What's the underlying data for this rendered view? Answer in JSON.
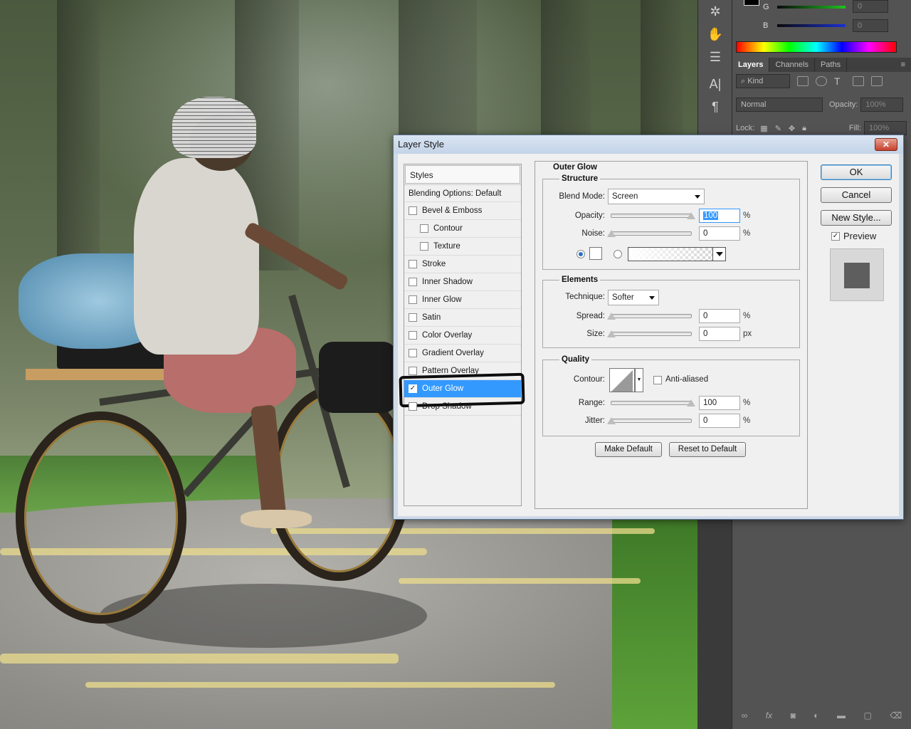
{
  "color_panel": {
    "g_label": "G",
    "b_label": "B",
    "g_value": "0",
    "b_value": "0",
    "accent_green": "#1fc21f",
    "accent_blue": "#1a2fd6"
  },
  "layers_panel": {
    "tabs": [
      {
        "label": "Layers",
        "active": true
      },
      {
        "label": "Channels",
        "active": false
      },
      {
        "label": "Paths",
        "active": false
      }
    ],
    "filter_label": "Kind",
    "blend_mode": "Normal",
    "opacity_label": "Opacity:",
    "opacity_value": "100%",
    "lock_label": "Lock:",
    "fill_label": "Fill:",
    "fill_value": "100%"
  },
  "dialog": {
    "title": "Layer Style",
    "close_label": "✕",
    "styles_header": "Styles",
    "blending_options": "Blending Options: Default",
    "style_items": [
      {
        "label": "Bevel & Emboss",
        "checked": false,
        "indent": false
      },
      {
        "label": "Contour",
        "checked": false,
        "indent": true
      },
      {
        "label": "Texture",
        "checked": false,
        "indent": true
      },
      {
        "label": "Stroke",
        "checked": false,
        "indent": false
      },
      {
        "label": "Inner Shadow",
        "checked": false,
        "indent": false
      },
      {
        "label": "Inner Glow",
        "checked": false,
        "indent": false
      },
      {
        "label": "Satin",
        "checked": false,
        "indent": false
      },
      {
        "label": "Color Overlay",
        "checked": false,
        "indent": false
      },
      {
        "label": "Gradient Overlay",
        "checked": false,
        "indent": false
      },
      {
        "label": "Pattern Overlay",
        "checked": false,
        "indent": false
      },
      {
        "label": "Outer Glow",
        "checked": true,
        "indent": false,
        "selected": true
      },
      {
        "label": "Drop Shadow",
        "checked": false,
        "indent": false
      }
    ],
    "outer_glow": {
      "title": "Outer Glow",
      "structure_title": "Structure",
      "blend_mode_label": "Blend Mode:",
      "blend_mode_value": "Screen",
      "opacity_label": "Opacity:",
      "opacity_value": "100",
      "opacity_level": 1.0,
      "noise_label": "Noise:",
      "noise_value": "0",
      "noise_level": 0.0,
      "percent": "%",
      "px": "px",
      "glow_color": "#ffffff",
      "elements_title": "Elements",
      "technique_label": "Technique:",
      "technique_value": "Softer",
      "spread_label": "Spread:",
      "spread_value": "0",
      "spread_level": 0.0,
      "size_label": "Size:",
      "size_value": "0",
      "size_level": 0.0,
      "quality_title": "Quality",
      "contour_label": "Contour:",
      "anti_aliased_label": "Anti-aliased",
      "anti_aliased_checked": false,
      "range_label": "Range:",
      "range_value": "100",
      "range_level": 1.0,
      "jitter_label": "Jitter:",
      "jitter_value": "0",
      "jitter_level": 0.0,
      "make_default": "Make Default",
      "reset_default": "Reset to Default"
    },
    "ok_label": "OK",
    "cancel_label": "Cancel",
    "new_style_label": "New Style...",
    "preview_label": "Preview",
    "preview_checked": true
  }
}
